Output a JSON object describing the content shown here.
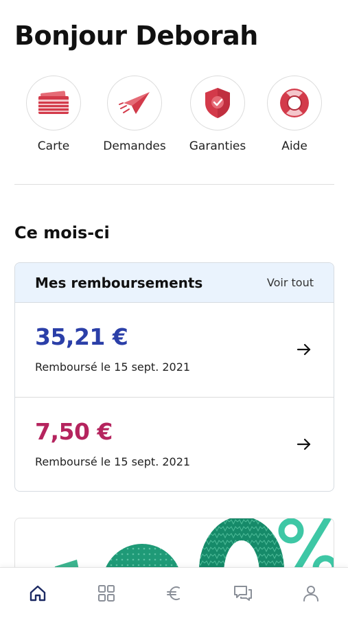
{
  "header": {
    "greeting": "Bonjour Deborah"
  },
  "shortcuts": [
    {
      "label": "Carte",
      "icon": "card-icon"
    },
    {
      "label": "Demandes",
      "icon": "paper-plane-icon"
    },
    {
      "label": "Garanties",
      "icon": "shield-check-icon"
    },
    {
      "label": "Aide",
      "icon": "lifebuoy-icon"
    }
  ],
  "month": {
    "title": "Ce mois-ci"
  },
  "reimbursements": {
    "title": "Mes remboursements",
    "see_all": "Voir tout",
    "items": [
      {
        "amount": "35,21 €",
        "date": "Remboursé le 15 sept. 2021",
        "color": "#2b3fa8"
      },
      {
        "amount": "7,50 €",
        "date": "Remboursé le 15 sept. 2021",
        "color": "#b5245e"
      }
    ]
  },
  "nav": [
    {
      "icon": "home-icon",
      "active": true
    },
    {
      "icon": "grid-icon",
      "active": false
    },
    {
      "icon": "euro-icon",
      "active": false
    },
    {
      "icon": "chat-icon",
      "active": false
    },
    {
      "icon": "profile-icon",
      "active": false
    }
  ],
  "colors": {
    "accent_red": "#d33a4a",
    "navy": "#1c2a63",
    "nav_inactive": "#8a8f98",
    "card_header_bg": "#eaf3fd",
    "promo_green": "#1f9a77"
  }
}
